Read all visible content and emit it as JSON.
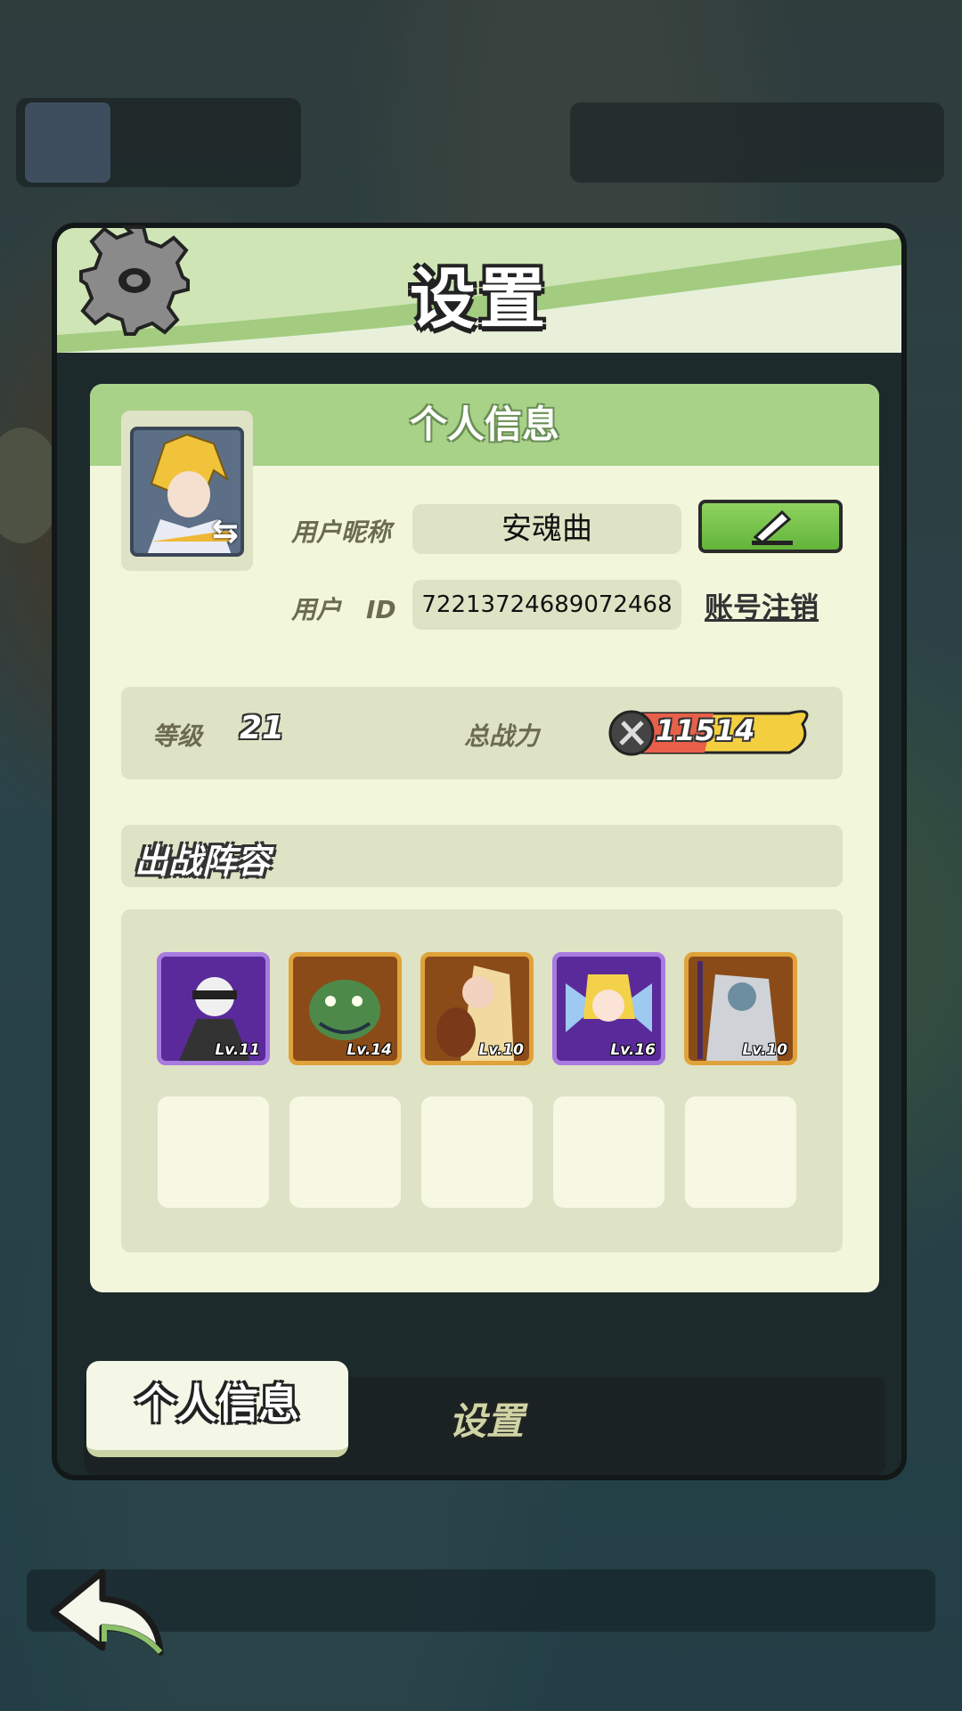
{
  "panel": {
    "title": "设置"
  },
  "profile": {
    "section_title": "个人信息",
    "nickname_label": "用户昵称",
    "nickname": "安魂曲",
    "id_label": "用户　ID",
    "user_id": "7221372468907246​8",
    "delete_account": "账号注销"
  },
  "stats": {
    "level_label": "等级",
    "level": "21",
    "power_label": "总战力",
    "power": "11514"
  },
  "lineup": {
    "title": "出战阵容",
    "heroes": [
      {
        "level": "Lv.11",
        "rarity": "purple"
      },
      {
        "level": "Lv.14",
        "rarity": "gold"
      },
      {
        "level": "Lv.10",
        "rarity": "gold"
      },
      {
        "level": "Lv.16",
        "rarity": "purple"
      },
      {
        "level": "Lv.10",
        "rarity": "gold"
      }
    ]
  },
  "tabs": {
    "active": "个人信息",
    "inactive": "设置"
  },
  "icons": [
    "gear-icon",
    "edit-pencil-icon",
    "swap-icon",
    "sword-shield-icon",
    "back-arrow-icon"
  ],
  "colors": {
    "header_green": "#a3cc80",
    "card_bg": "#f2f7dc",
    "button_green": "#63b43a",
    "purple_frame": "#a77be0",
    "gold_frame": "#e0a23a"
  }
}
